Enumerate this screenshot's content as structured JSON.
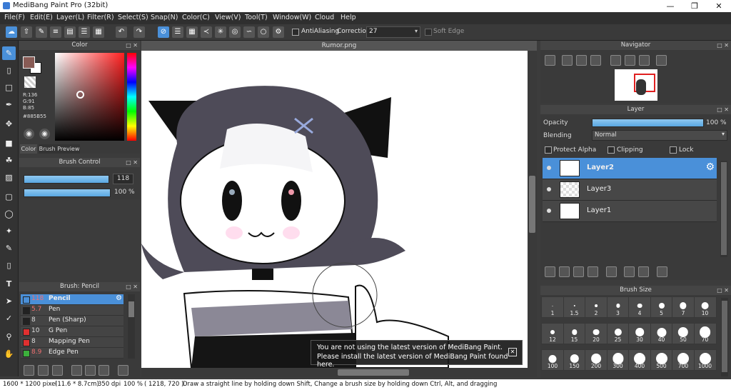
{
  "app": {
    "title": "MediBang Paint Pro (32bit)"
  },
  "menu": [
    "File(F)",
    "Edit(E)",
    "Layer(L)",
    "Filter(R)",
    "Select(S)",
    "Snap(N)",
    "Color(C)",
    "View(V)",
    "Tool(T)",
    "Window(W)",
    "Cloud",
    "Help"
  ],
  "toolbar": {
    "antialiasing_label": "AntiAliasing",
    "correction_label": "Correction",
    "correction_value": "27",
    "soft_edge_label": "Soft Edge"
  },
  "color_panel": {
    "title": "Color",
    "r": "R:136",
    "g": "G:91",
    "b": "B:85",
    "hex": "#885B55",
    "fg_color": "#885B55",
    "tab_color": "Color",
    "tab_brush_preview": "Brush Preview"
  },
  "brush_control": {
    "title": "Brush Control",
    "size_value": "118",
    "opacity_value": "100 %",
    "size_fraction": 0.98,
    "opacity_fraction": 1.0
  },
  "brush_list": {
    "title": "Brush: Pencil",
    "items": [
      {
        "size": "118",
        "name": "Pencil",
        "color": "#4a90d9"
      },
      {
        "size": "5.7",
        "name": "Pen",
        "color": "#222222"
      },
      {
        "size": "8",
        "name": "Pen (Sharp)",
        "color": "#222222"
      },
      {
        "size": "10",
        "name": "G Pen",
        "color": "#e03030"
      },
      {
        "size": "8",
        "name": "Mapping Pen",
        "color": "#e03030"
      },
      {
        "size": "8.9",
        "name": "Edge Pen",
        "color": "#3cb03c"
      }
    ]
  },
  "document": {
    "tab": "Rumor.png"
  },
  "navigator": {
    "title": "Navigator"
  },
  "layer_panel": {
    "title": "Layer",
    "opacity_label": "Opacity",
    "opacity_value": "100 %",
    "blending_label": "Blending",
    "blending_value": "Normal",
    "protect_alpha": "Protect Alpha",
    "clipping": "Clipping",
    "lock": "Lock",
    "layers": [
      {
        "name": "Layer2",
        "selected": true
      },
      {
        "name": "Layer3",
        "selected": false
      },
      {
        "name": "Layer1",
        "selected": false
      }
    ]
  },
  "brush_size": {
    "title": "Brush Size",
    "sizes": [
      "1",
      "1.5",
      "2",
      "3",
      "4",
      "5",
      "7",
      "10",
      "12",
      "15",
      "20",
      "25",
      "30",
      "40",
      "50",
      "70",
      "100",
      "150",
      "200",
      "300",
      "400",
      "500",
      "700",
      "1000"
    ]
  },
  "notice": {
    "line1": "You are not using the latest version of MediBang Paint.",
    "line2": "Please install the latest version of MediBang Paint found here."
  },
  "status": {
    "size": "1600 * 1200 pixel",
    "dimensions": "(11.6 * 8.7cm)",
    "dpi": "350 dpi",
    "zoom": "100 %",
    "coords": "( 1218, 720 )",
    "hint": "Draw a straight line by holding down Shift, Change a brush size by holding down Ctrl, Alt, and dragging"
  }
}
